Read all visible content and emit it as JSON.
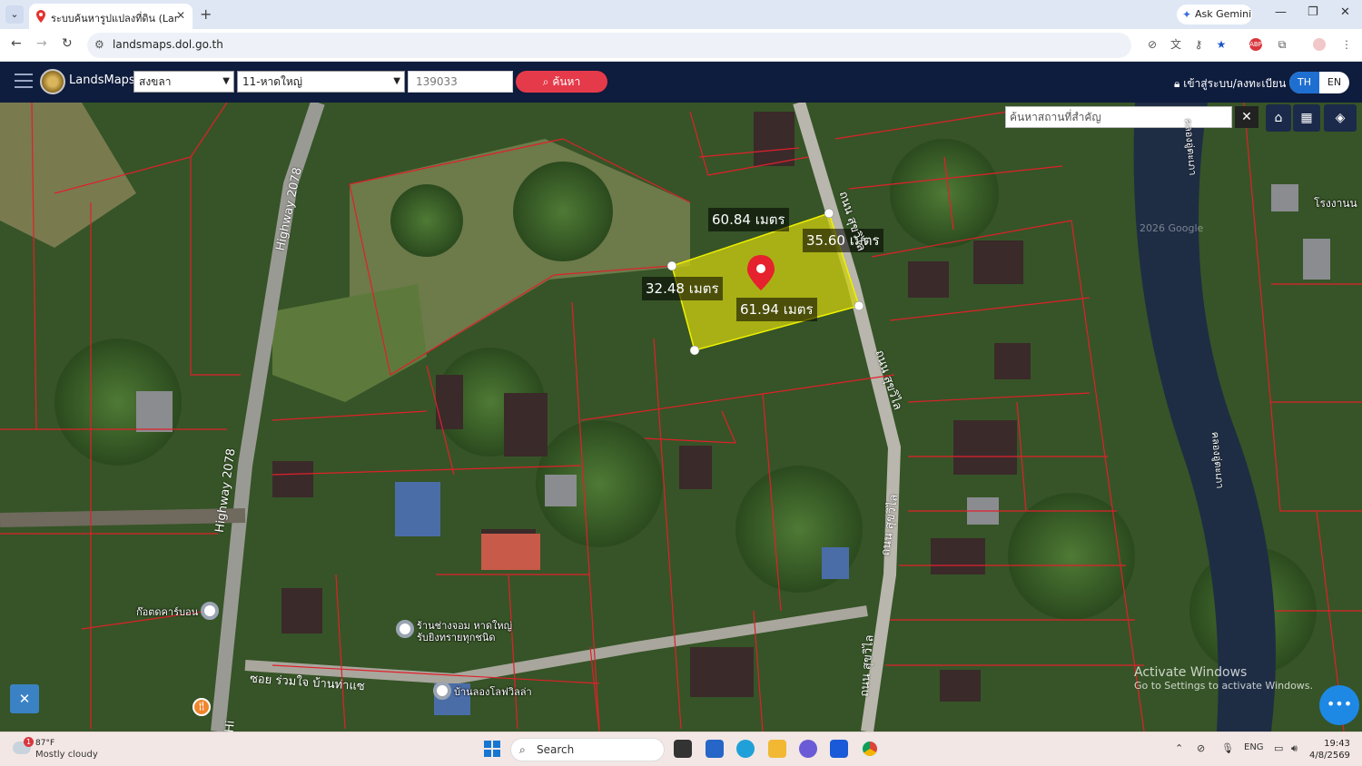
{
  "browser": {
    "tab_title": "ระบบค้นหารูปแปลงที่ดิน (LandsMaps)",
    "url": "landsmaps.dol.go.th",
    "gemini_label": "Ask Gemini",
    "tab_close": "✕",
    "new_tab": "+",
    "tab_menu": "⌄"
  },
  "app": {
    "brand": "LandsMaps",
    "province": "สงขลา",
    "district": "11-หาดใหญ่",
    "parcel_number": "139033",
    "search_label": "ค้นหา",
    "login_label": "เข้าสู่ระบบ/ลงทะเบียน",
    "lang_th": "TH",
    "lang_en": "EN"
  },
  "map": {
    "search_placeholder": "ค้นหาสถานที่สำคัญ",
    "measurements": {
      "top": "60.84 เมตร",
      "right": "35.60 เมตร",
      "left": "32.48 เมตร",
      "bottom": "61.94 เมตร"
    },
    "road_labels": {
      "highway_1": "Highway 2078",
      "highway_2": "Highway 2078",
      "highway_3": "Hi",
      "soi": "ซอย ร่วมใจ บ้านท่าแซ",
      "road_1": "ถนน สุขวิไล",
      "road_2": "ถนน สุขวิไล",
      "road_3": "ถนน สุขวิไล",
      "road_4": "ถนน สุขวิไล",
      "canal_1": "คลองอู่ตะเภา",
      "canal_2": "คลองอู่ตะเภา"
    },
    "poi": {
      "p1": "ก๊อตดคาร์บอน",
      "p2": "ร้านช่างจอม หาดใหญ่",
      "p2_sub": "รับยิงทรายทุกชนิด",
      "p3": "บ้านลองโลฟวิลล่า",
      "school": "โรงงานน",
      "copyright": "2026 Google"
    },
    "watermark_title": "Activate Windows",
    "watermark_sub": "Go to Settings to activate Windows."
  },
  "taskbar": {
    "temp": "87°F",
    "condition": "Mostly cloudy",
    "weather_badge": "1",
    "search_label": "Search",
    "lang": "ENG",
    "time": "19:43",
    "date": "4/8/2569"
  },
  "colors": {
    "app_header": "#0e1c3d",
    "search_button": "#e53a4a",
    "parcel_fill": "#cfcf10",
    "parcel_lines": "#e0202a",
    "lang_active": "#1f6fd1"
  }
}
